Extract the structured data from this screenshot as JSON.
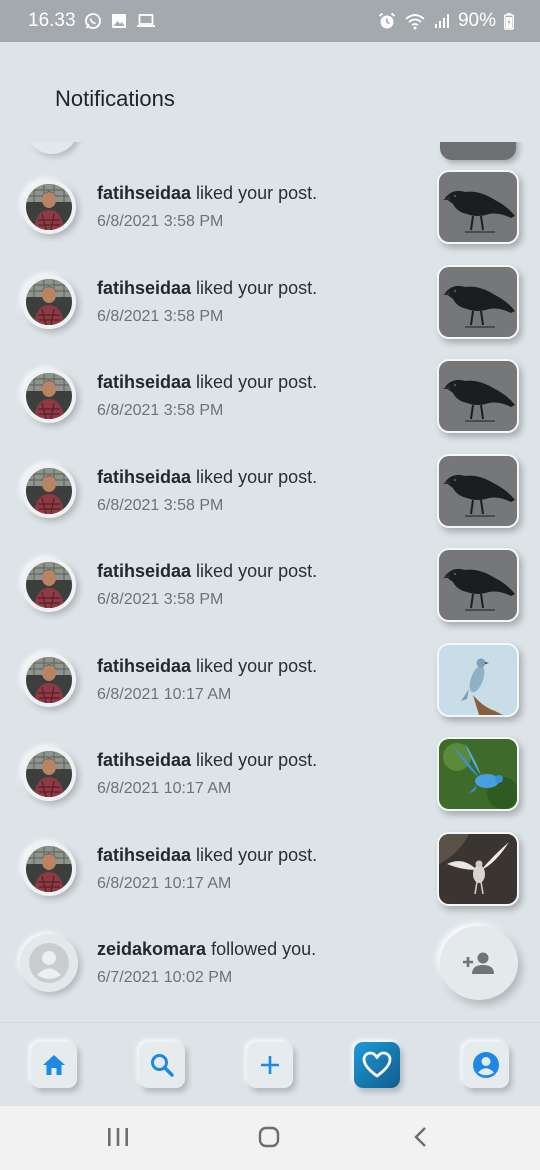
{
  "status_bar": {
    "time": "16.33",
    "battery": "90%",
    "icons": [
      "whatsapp-icon",
      "gallery-icon",
      "laptop-icon",
      "alarm-icon",
      "wifi-icon",
      "signal-icon",
      "battery-icon"
    ]
  },
  "header": {
    "title": "Notifications"
  },
  "notifications": [
    {
      "username": "fatihseidaa",
      "action": " liked your post.",
      "time": "6/8/2021 3:58 PM",
      "thumb": "crow"
    },
    {
      "username": "fatihseidaa",
      "action": " liked your post.",
      "time": "6/8/2021 3:58 PM",
      "thumb": "crow"
    },
    {
      "username": "fatihseidaa",
      "action": " liked your post.",
      "time": "6/8/2021 3:58 PM",
      "thumb": "crow"
    },
    {
      "username": "fatihseidaa",
      "action": " liked your post.",
      "time": "6/8/2021 3:58 PM",
      "thumb": "crow"
    },
    {
      "username": "fatihseidaa",
      "action": " liked your post.",
      "time": "6/8/2021 3:58 PM",
      "thumb": "crow"
    },
    {
      "username": "fatihseidaa",
      "action": " liked your post.",
      "time": "6/8/2021 10:17 AM",
      "thumb": "perched-bird"
    },
    {
      "username": "fatihseidaa",
      "action": " liked your post.",
      "time": "6/8/2021 10:17 AM",
      "thumb": "bluebird"
    },
    {
      "username": "fatihseidaa",
      "action": " liked your post.",
      "time": "6/8/2021 10:17 AM",
      "thumb": "white-bird"
    },
    {
      "username": "zeidakomara",
      "action": " followed you.",
      "time": "6/7/2021 10:02 PM",
      "thumb": "follow-button"
    }
  ],
  "bottom_nav": {
    "items": [
      {
        "icon": "home-icon",
        "active": false
      },
      {
        "icon": "search-icon",
        "active": false
      },
      {
        "icon": "add-icon",
        "active": false
      },
      {
        "icon": "heart-icon",
        "active": true
      },
      {
        "icon": "profile-icon",
        "active": false
      }
    ]
  },
  "system_nav": {
    "buttons": [
      "recent-apps-icon",
      "home-circle-icon",
      "back-icon"
    ]
  },
  "colors": {
    "background": "#dde4e8",
    "status_bar": "#a3a9ad",
    "accent": "#1e88e5",
    "active_nav": "#1a87c0"
  }
}
